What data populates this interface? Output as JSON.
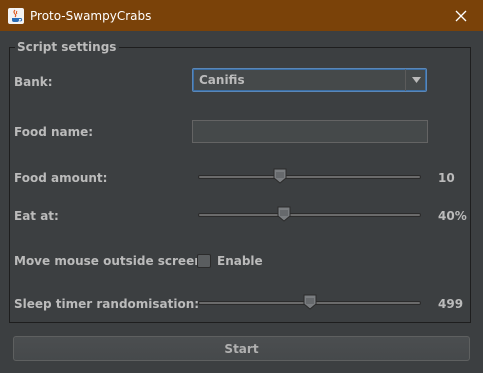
{
  "window": {
    "title": "Proto-SwampyCrabs",
    "title_color": "#7a4209",
    "app_icon": "java-coffee-cup-icon",
    "close_icon": "close-icon"
  },
  "settings": {
    "legend": "Script settings",
    "bank": {
      "label": "Bank:",
      "value": "Canifis",
      "dropdown_icon": "chevron-down-icon"
    },
    "food_name": {
      "label": "Food name:",
      "value": ""
    },
    "food_amount": {
      "label": "Food amount:",
      "value_text": "10",
      "fraction": 0.36
    },
    "eat_at": {
      "label": "Eat at:",
      "value_text": "40%",
      "fraction": 0.38
    },
    "move_mouse": {
      "label": "Move mouse outside screen?",
      "checkbox_label": "Enable",
      "checked": false
    },
    "sleep_timer": {
      "label": "Sleep timer randomisation:",
      "value_text": "499",
      "fraction": 0.5
    }
  },
  "actions": {
    "start_label": "Start"
  },
  "colors": {
    "background": "#3c3f41",
    "text": "#bbbbbb",
    "focus_border": "#5a87b8"
  }
}
